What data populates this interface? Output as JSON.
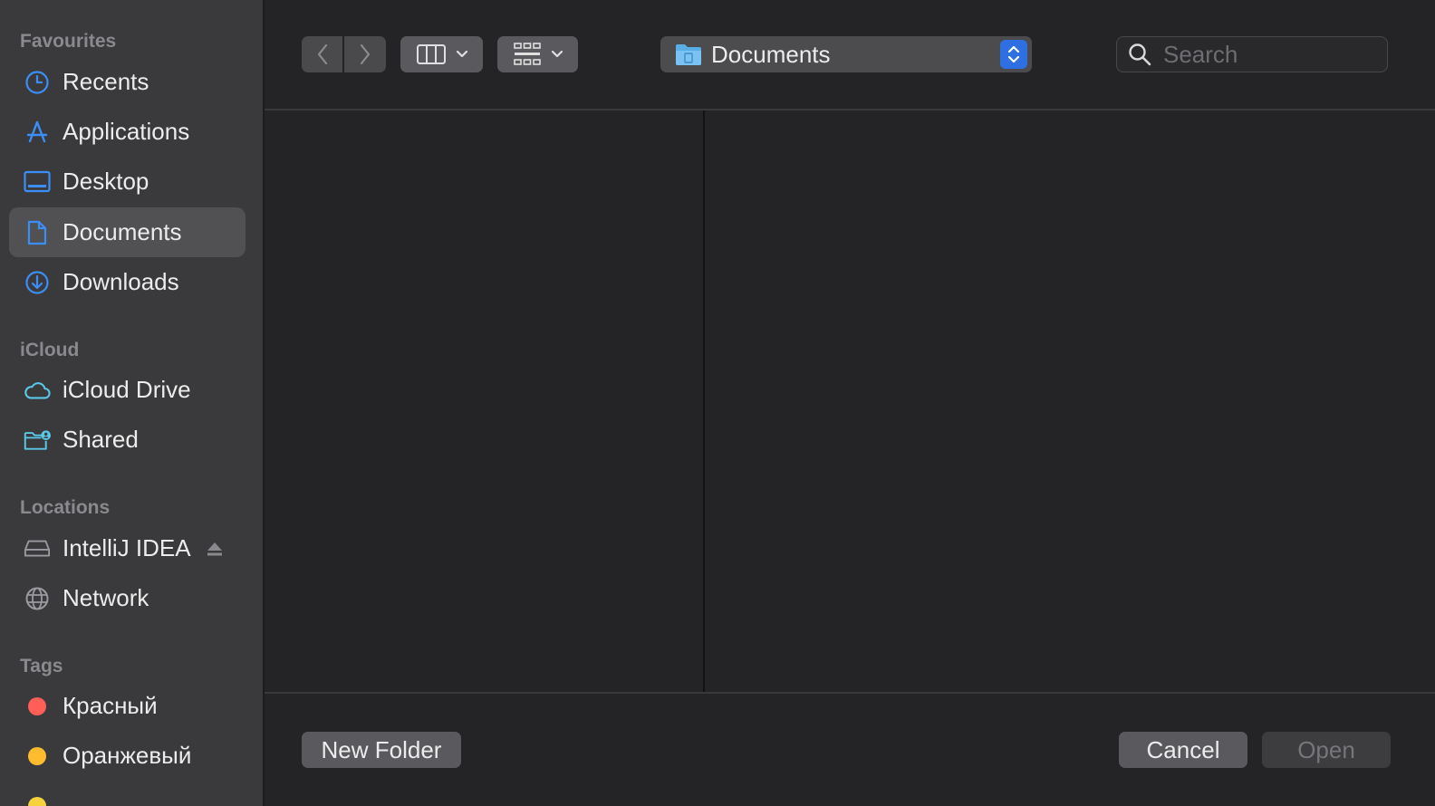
{
  "sidebar": {
    "sections": [
      {
        "title": "Favourites"
      },
      {
        "title": "iCloud"
      },
      {
        "title": "Locations"
      },
      {
        "title": "Tags"
      }
    ],
    "favourites": [
      {
        "label": "Recents",
        "icon": "clock-icon"
      },
      {
        "label": "Applications",
        "icon": "applications-icon"
      },
      {
        "label": "Desktop",
        "icon": "desktop-icon"
      },
      {
        "label": "Documents",
        "icon": "document-icon",
        "selected": true
      },
      {
        "label": "Downloads",
        "icon": "download-icon"
      }
    ],
    "icloud": [
      {
        "label": "iCloud Drive",
        "icon": "cloud-icon"
      },
      {
        "label": "Shared",
        "icon": "shared-folder-icon"
      }
    ],
    "locations": [
      {
        "label": "IntelliJ IDEA",
        "icon": "drive-icon",
        "eject": true
      },
      {
        "label": "Network",
        "icon": "globe-icon"
      }
    ],
    "tags": [
      {
        "label": "Красный",
        "color": "#ff5f57"
      },
      {
        "label": "Оранжевый",
        "color": "#febc2e"
      }
    ]
  },
  "toolbar": {
    "path": "Documents",
    "search_placeholder": "Search"
  },
  "footer": {
    "new_folder": "New Folder",
    "cancel": "Cancel",
    "open": "Open"
  },
  "colors": {
    "accent": "#2f6fe4",
    "icon_blue": "#3a8ef6",
    "icon_cyan": "#5ac8e6"
  }
}
